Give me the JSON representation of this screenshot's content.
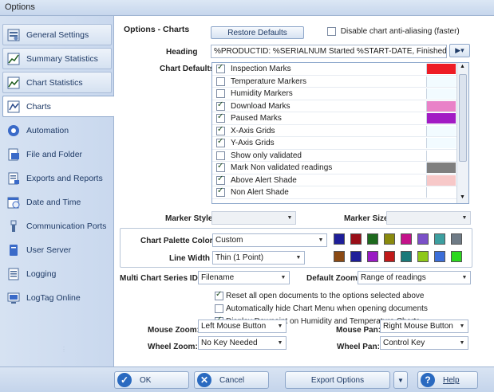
{
  "window": {
    "title": "Options"
  },
  "sidebar": {
    "items": [
      {
        "label": "General Settings",
        "icon": "settings-icon"
      },
      {
        "label": "Summary Statistics",
        "icon": "chart-icon"
      },
      {
        "label": "Chart Statistics",
        "icon": "chart-icon"
      },
      {
        "label": "Charts",
        "icon": "line-chart-icon"
      },
      {
        "label": "Automation",
        "icon": "gear-icon"
      },
      {
        "label": "File and Folder",
        "icon": "folder-icon"
      },
      {
        "label": "Exports and Reports",
        "icon": "document-icon"
      },
      {
        "label": "Date and Time",
        "icon": "calendar-icon"
      },
      {
        "label": "Communication Ports",
        "icon": "usb-icon"
      },
      {
        "label": "User Server",
        "icon": "server-icon"
      },
      {
        "label": "Logging",
        "icon": "log-icon"
      },
      {
        "label": "LogTag Online",
        "icon": "monitor-icon"
      }
    ]
  },
  "main": {
    "section_title": "Options - Charts",
    "restore_defaults": "Restore Defaults",
    "disable_antialias": {
      "label": "Disable chart anti-aliasing (faster)",
      "checked": false
    },
    "heading": {
      "label": "Heading",
      "value": "%PRODUCTID: %SERIALNUM Started %START-DATE, Finished %FINISH"
    },
    "chart_defaults": {
      "label": "Chart Defaults",
      "items": [
        {
          "label": "Inspection Marks",
          "checked": true,
          "color": "#ee1c25"
        },
        {
          "label": "Temperature Markers",
          "checked": false,
          "color": "#f2fbff"
        },
        {
          "label": "Humidity Markers",
          "checked": false,
          "color": "#f2fbff"
        },
        {
          "label": "Download Marks",
          "checked": true,
          "color": "#e982c8"
        },
        {
          "label": "Paused Marks",
          "checked": true,
          "color": "#a21ac4"
        },
        {
          "label": "X-Axis Grids",
          "checked": true,
          "color": "#f2fbff"
        },
        {
          "label": "Y-Axis Grids",
          "checked": true,
          "color": "#f2fbff"
        },
        {
          "label": "Show only validated",
          "checked": false,
          "color": "#ffffff"
        },
        {
          "label": "Mark Non validated readings",
          "checked": true,
          "color": "#7f7f7f"
        },
        {
          "label": "Above Alert Shade",
          "checked": true,
          "color": "#f7c8c8"
        },
        {
          "label": "Non Alert Shade",
          "checked": true,
          "color": "#ffffff"
        }
      ]
    },
    "marker_style": {
      "label": "Marker Style",
      "value": ""
    },
    "marker_size": {
      "label": "Marker Size",
      "value": ""
    },
    "palette_colors": {
      "label": "Chart Palette Colors",
      "value": "Custom",
      "colors": [
        "#1e1e99",
        "#990e18",
        "#1e6a1e",
        "#8a8a0e",
        "#c4128a",
        "#7b50c8",
        "#3d9fa0",
        "#6f7b86"
      ]
    },
    "line_width": {
      "label": "Line Width",
      "value": "Thin (1 Point)",
      "colors": [
        "#8b4a14",
        "#1e1e99",
        "#9a1ac4",
        "#c01a1a",
        "#1a7a7a",
        "#8ec818",
        "#3c6ed8",
        "#2cd81e"
      ]
    },
    "multi_chart_series": {
      "label": "Multi Chart Series ID:",
      "value": "Filename"
    },
    "default_zoom": {
      "label": "Default Zoom:",
      "value": "Range of readings"
    },
    "options": [
      {
        "label": "Reset all open documents to the options selected above",
        "checked": true
      },
      {
        "label": "Automatically hide Chart Menu when opening documents",
        "checked": false
      },
      {
        "label": "Display Dewpoint on Humidity and Temperature Charts",
        "checked": true
      }
    ],
    "mouse_zoom": {
      "label": "Mouse Zoom:",
      "value": "Left Mouse Button"
    },
    "wheel_zoom": {
      "label": "Wheel Zoom:",
      "value": "No Key Needed"
    },
    "mouse_pan": {
      "label": "Mouse Pan:",
      "value": "Right Mouse Button"
    },
    "wheel_pan": {
      "label": "Wheel Pan:",
      "value": "Control Key"
    }
  },
  "buttons": {
    "ok": "OK",
    "cancel": "Cancel",
    "export_options": "Export Options",
    "help": "Help"
  }
}
